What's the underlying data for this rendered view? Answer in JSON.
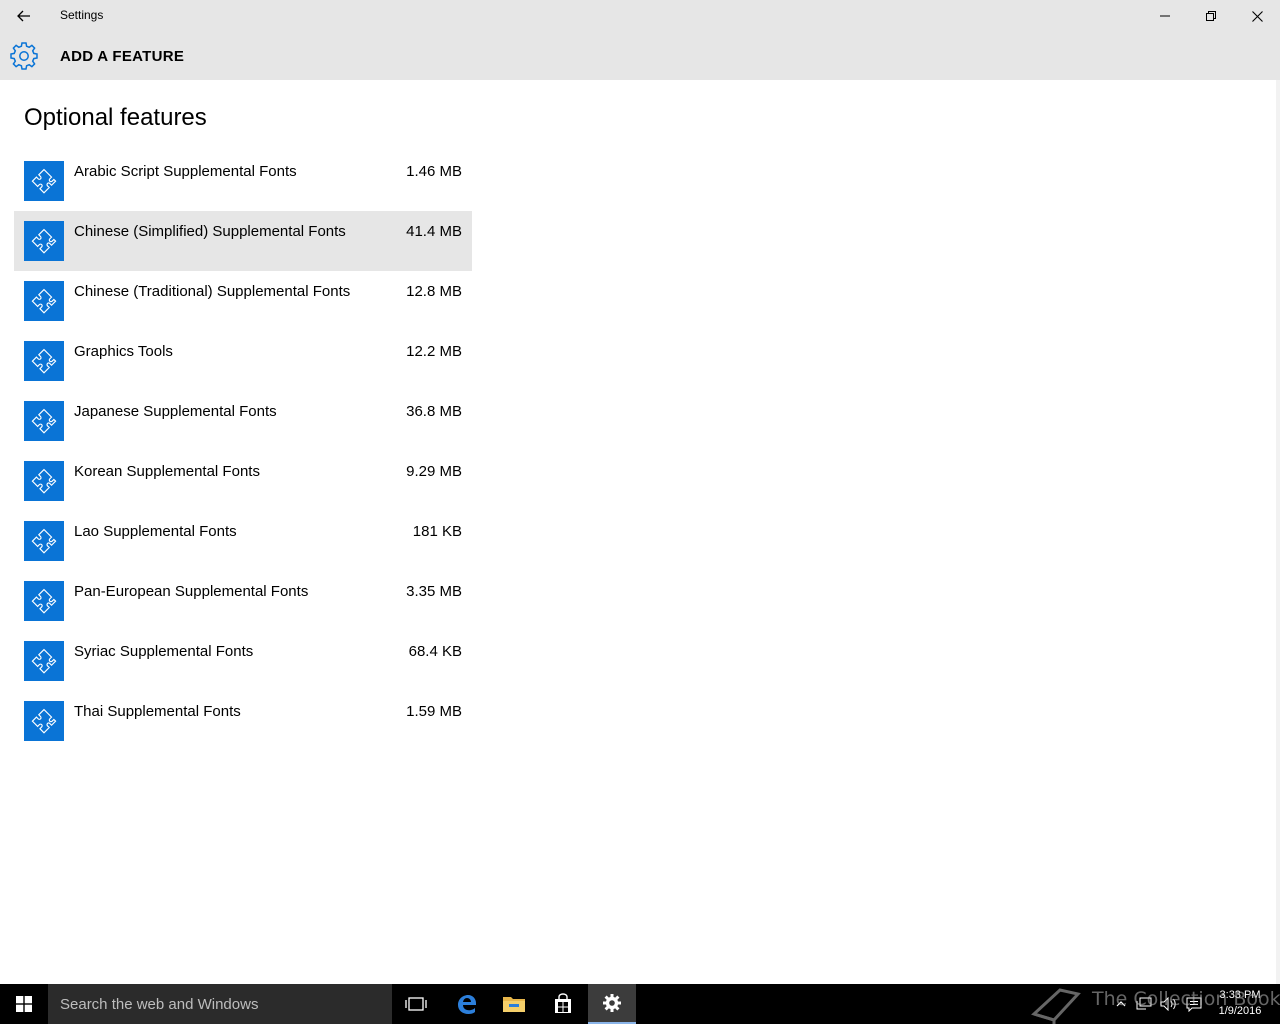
{
  "window": {
    "title": "Settings"
  },
  "header": {
    "title": "ADD A FEATURE"
  },
  "main": {
    "heading": "Optional features",
    "features": [
      {
        "name": "Arabic Script Supplemental Fonts",
        "size": "1.46 MB"
      },
      {
        "name": "Chinese (Simplified) Supplemental Fonts",
        "size": "41.4 MB",
        "selected": true
      },
      {
        "name": "Chinese (Traditional) Supplemental Fonts",
        "size": "12.8 MB"
      },
      {
        "name": "Graphics Tools",
        "size": "12.2 MB"
      },
      {
        "name": "Japanese Supplemental Fonts",
        "size": "36.8 MB"
      },
      {
        "name": "Korean Supplemental Fonts",
        "size": "9.29 MB"
      },
      {
        "name": "Lao Supplemental Fonts",
        "size": "181 KB"
      },
      {
        "name": "Pan-European Supplemental Fonts",
        "size": "3.35 MB"
      },
      {
        "name": "Syriac Supplemental Fonts",
        "size": "68.4 KB"
      },
      {
        "name": "Thai Supplemental Fonts",
        "size": "1.59 MB"
      }
    ],
    "feature_icon": "puzzle-piece-icon"
  },
  "taskbar": {
    "search_placeholder": "Search the web and Windows",
    "time": "3:33 PM",
    "date": "1/9/2016",
    "watermark": "The Collection Book"
  },
  "colors": {
    "accent": "#0a74d6",
    "chrome": "#e6e6e6",
    "taskbar": "#000000"
  }
}
